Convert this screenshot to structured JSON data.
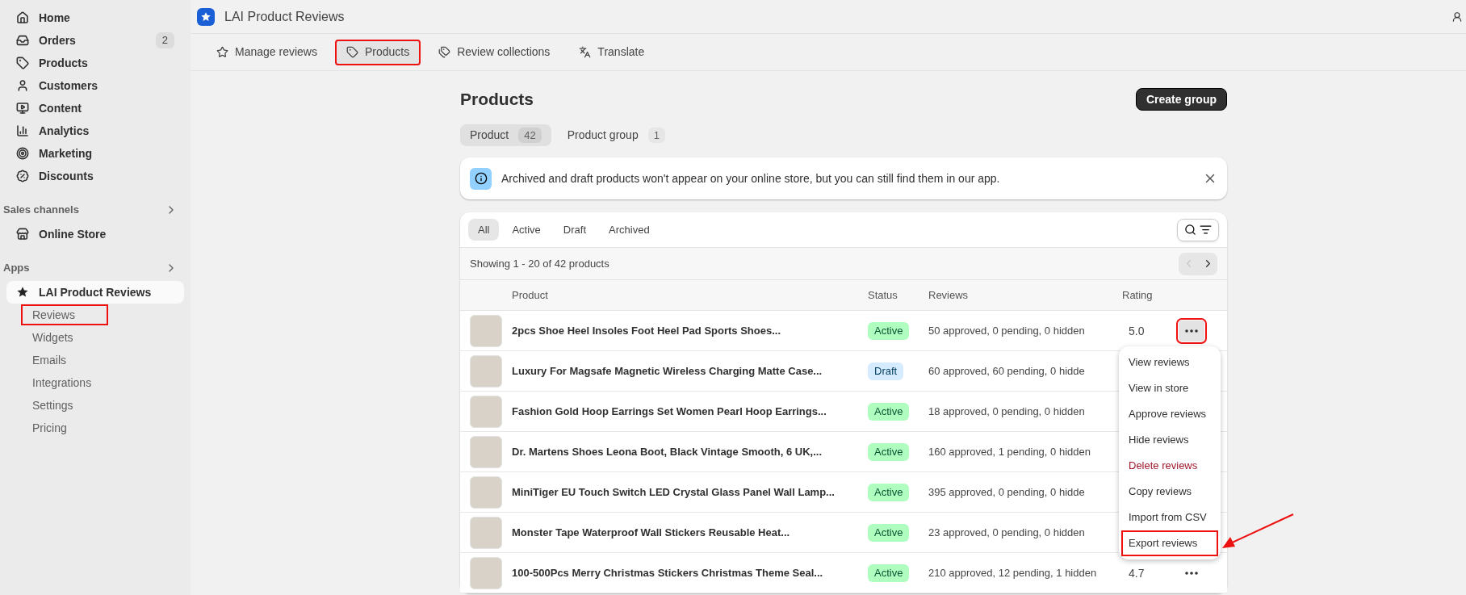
{
  "sidebar": {
    "nav_items": [
      {
        "label": "Home"
      },
      {
        "label": "Orders",
        "badge": "2"
      },
      {
        "label": "Products"
      },
      {
        "label": "Customers"
      },
      {
        "label": "Content"
      },
      {
        "label": "Analytics"
      },
      {
        "label": "Marketing"
      },
      {
        "label": "Discounts"
      }
    ],
    "sections": [
      {
        "title": "Sales channels",
        "items": [
          {
            "label": "Online Store",
            "selected": false
          }
        ]
      },
      {
        "title": "Apps",
        "items": [
          {
            "label": "LAI Product Reviews",
            "selected": true,
            "children": [
              {
                "label": "Reviews",
                "highlighted": true
              },
              {
                "label": "Widgets",
                "highlighted": false
              },
              {
                "label": "Emails",
                "highlighted": false
              },
              {
                "label": "Integrations",
                "highlighted": false
              },
              {
                "label": "Settings",
                "highlighted": false
              },
              {
                "label": "Pricing",
                "highlighted": false
              }
            ]
          }
        ]
      }
    ]
  },
  "app_header": {
    "title": "LAI Product Reviews"
  },
  "tabs": [
    {
      "label": "Manage reviews",
      "selected": false,
      "highlighted": false
    },
    {
      "label": "Products",
      "selected": true,
      "highlighted": true
    },
    {
      "label": "Review collections",
      "selected": false,
      "highlighted": false
    },
    {
      "label": "Translate",
      "selected": false,
      "highlighted": false
    }
  ],
  "page": {
    "title": "Products",
    "primary_button": "Create group",
    "segments": [
      {
        "label": "Product",
        "count": "42",
        "selected": true
      },
      {
        "label": "Product group",
        "count": "1",
        "selected": false
      }
    ],
    "banner": {
      "text": "Archived and draft products won't appear on your online store, but you can still find them in our app."
    },
    "table": {
      "filters": [
        {
          "label": "All",
          "selected": true
        },
        {
          "label": "Active",
          "selected": false
        },
        {
          "label": "Draft",
          "selected": false
        },
        {
          "label": "Archived",
          "selected": false
        }
      ],
      "summary": "Showing 1 - 20 of 42 products",
      "pagination": {
        "prev_disabled": true,
        "next_disabled": false
      },
      "columns": [
        "Product",
        "Status",
        "Reviews",
        "Rating"
      ],
      "rows": [
        {
          "product": "2pcs Shoe Heel Insoles Foot Heel Pad Sports Shoes...",
          "status": {
            "label": "Active",
            "kind": "active"
          },
          "reviews": "50 approved, 0 pending, 0 hidden",
          "rating": "5.0",
          "more_highlighted": true
        },
        {
          "product": "Luxury For Magsafe Magnetic Wireless Charging Matte Case...",
          "status": {
            "label": "Draft",
            "kind": "draft"
          },
          "reviews": "60 approved, 60 pending, 0 hidde"
        },
        {
          "product": "Fashion Gold Hoop Earrings Set Women Pearl Hoop Earrings...",
          "status": {
            "label": "Active",
            "kind": "active"
          },
          "reviews": "18 approved, 0 pending, 0 hidden"
        },
        {
          "product": "Dr. Martens Shoes Leona Boot, Black Vintage Smooth, 6 UK,...",
          "status": {
            "label": "Active",
            "kind": "active"
          },
          "reviews": "160 approved, 1 pending, 0 hidden"
        },
        {
          "product": "MiniTiger EU Touch Switch LED Crystal Glass Panel Wall Lamp...",
          "status": {
            "label": "Active",
            "kind": "active"
          },
          "reviews": "395 approved, 0 pending, 0 hidde"
        },
        {
          "product": "Monster Tape Waterproof Wall Stickers Reusable Heat...",
          "status": {
            "label": "Active",
            "kind": "active"
          },
          "reviews": "23 approved, 0 pending, 0 hidden"
        },
        {
          "product": "100-500Pcs Merry Christmas Stickers Christmas Theme Seal...",
          "status": {
            "label": "Active",
            "kind": "active"
          },
          "reviews": "210 approved, 12 pending, 1 hidden",
          "rating": "4.7",
          "more_highlighted": false
        }
      ]
    },
    "row_menu": {
      "items": [
        {
          "label": "View reviews",
          "kind": "normal",
          "highlighted": false
        },
        {
          "label": "View in store",
          "kind": "normal",
          "highlighted": false
        },
        {
          "label": "Approve reviews",
          "kind": "normal",
          "highlighted": false
        },
        {
          "label": "Hide reviews",
          "kind": "normal",
          "highlighted": false
        },
        {
          "label": "Delete reviews",
          "kind": "destructive",
          "highlighted": false
        },
        {
          "label": "Copy reviews",
          "kind": "normal",
          "highlighted": false
        },
        {
          "label": "Import from CSV",
          "kind": "normal",
          "highlighted": false
        },
        {
          "label": "Export reviews",
          "kind": "normal",
          "highlighted": true
        }
      ]
    }
  }
}
